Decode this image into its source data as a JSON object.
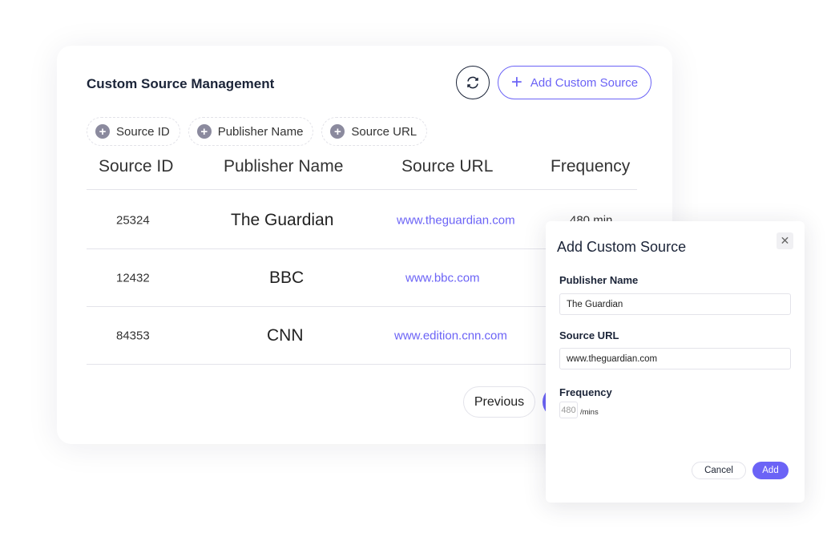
{
  "card": {
    "title": "Custom Source Management",
    "add_button": "Add Custom Source",
    "filters": [
      "Source ID",
      "Publisher Name",
      "Source URL"
    ],
    "columns": [
      "Source ID",
      "Publisher Name",
      "Source URL",
      "Frequency"
    ],
    "rows": [
      {
        "id": "25324",
        "publisher": "The Guardian",
        "url": "www.theguardian.com",
        "frequency": "480 min"
      },
      {
        "id": "12432",
        "publisher": "BBC",
        "url": "www.bbc.com",
        "frequency": ""
      },
      {
        "id": "84353",
        "publisher": "CNN",
        "url": "www.edition.cnn.com",
        "frequency": ""
      }
    ],
    "previous": "Previous"
  },
  "modal": {
    "title": "Add Custom Source",
    "publisher_label": "Publisher Name",
    "publisher_value": "The Guardian",
    "url_label": "Source URL",
    "url_value": "www.theguardian.com",
    "frequency_label": "Frequency",
    "frequency_value": "480",
    "frequency_unit": "/mins",
    "cancel": "Cancel",
    "add": "Add"
  },
  "colors": {
    "accent": "#6b63f6",
    "text": "#1b2438"
  }
}
